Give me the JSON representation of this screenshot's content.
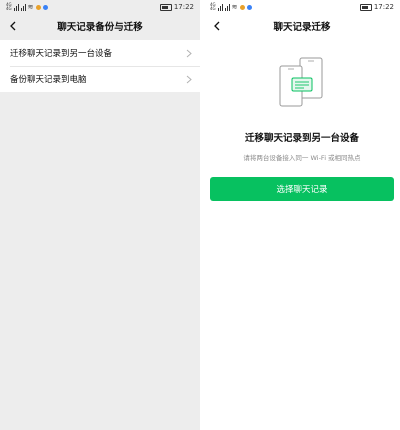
{
  "status": {
    "time": "17:22",
    "carrier_top": "4G",
    "carrier_bottom": "4G"
  },
  "left": {
    "title": "聊天记录备份与迁移",
    "items": [
      {
        "label": "迁移聊天记录到另一台设备"
      },
      {
        "label": "备份聊天记录到电脑"
      }
    ]
  },
  "right": {
    "title": "聊天记录迁移",
    "heading": "迁移聊天记录到另一台设备",
    "subtext": "请将两台设备接入同一 Wi-Fi 或相同热点",
    "button_label": "选择聊天记录"
  },
  "colors": {
    "accent": "#07c160",
    "background_gray": "#ededed"
  },
  "icons": [
    "back-arrow-icon",
    "chevron-right-icon",
    "phone-transfer-illustration"
  ]
}
